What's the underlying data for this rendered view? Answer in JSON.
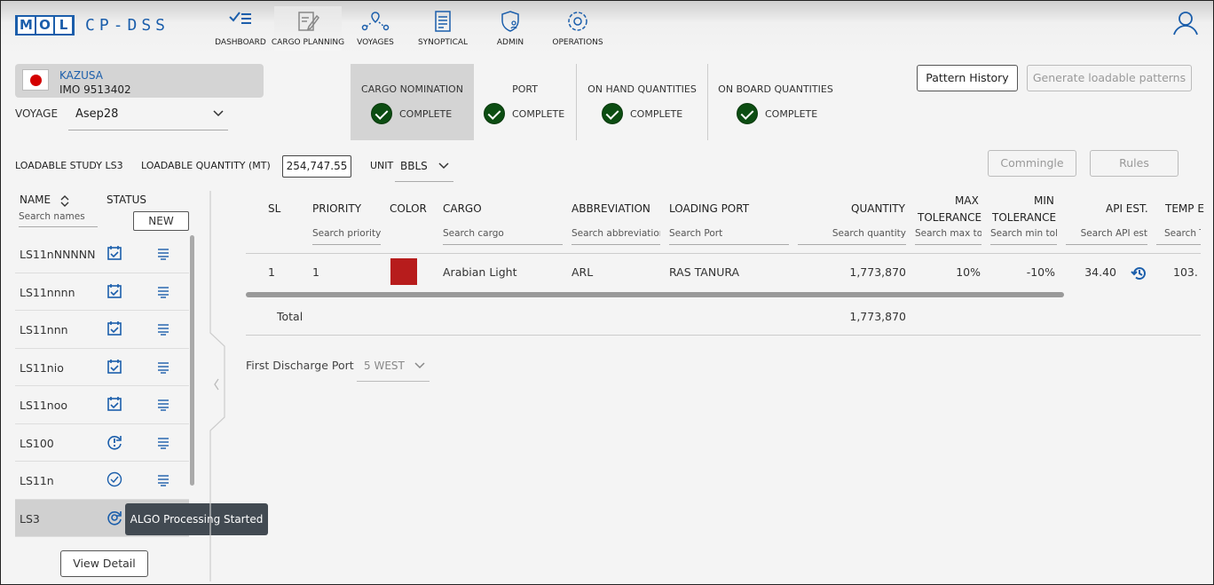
{
  "app": {
    "logo_letters": [
      "M",
      "O",
      "L"
    ],
    "logo_name": "CP-DSS"
  },
  "nav": [
    {
      "label": "DASHBOARD",
      "icon": "dashboard-icon"
    },
    {
      "label": "CARGO PLANNING",
      "icon": "cargo-planning-icon",
      "active": true
    },
    {
      "label": "VOYAGES",
      "icon": "voyages-icon"
    },
    {
      "label": "SYNOPTICAL",
      "icon": "synoptical-icon"
    },
    {
      "label": "ADMIN",
      "icon": "admin-icon"
    },
    {
      "label": "OPERATIONS",
      "icon": "operations-icon"
    }
  ],
  "vessel": {
    "name": "KAZUSA",
    "imo": "IMO 9513402",
    "flag": "japan-flag-icon"
  },
  "voyage": {
    "label": "VOYAGE",
    "value": "Asep28"
  },
  "steps": [
    {
      "title": "CARGO NOMINATION",
      "state": "COMPLETE"
    },
    {
      "title": "PORT",
      "state": "COMPLETE"
    },
    {
      "title": "ON HAND QUANTITIES",
      "state": "COMPLETE"
    },
    {
      "title": "ON BOARD QUANTITIES",
      "state": "COMPLETE"
    }
  ],
  "buttons": {
    "pattern_history": "Pattern History",
    "generate": "Generate loadable patterns",
    "commingle": "Commingle",
    "rules": "Rules",
    "new": "NEW",
    "view_detail": "View Detail"
  },
  "study": {
    "label": "LOADABLE STUDY LS3",
    "qty_label": "LOADABLE QUANTITY (MT)",
    "qty_value": "254,747.55",
    "unit_label": "UNIT",
    "unit_value": "BBLS"
  },
  "list": {
    "name_header": "NAME",
    "status_header": "STATUS",
    "search_placeholder": "Search names",
    "items": [
      {
        "name": "LS11nNNNNN",
        "status": "calendar-check-icon"
      },
      {
        "name": "LS11nnnn",
        "status": "calendar-check-icon"
      },
      {
        "name": "LS11nnn",
        "status": "calendar-check-icon"
      },
      {
        "name": "LS11nio",
        "status": "calendar-check-icon"
      },
      {
        "name": "LS11noo",
        "status": "calendar-check-icon"
      },
      {
        "name": "LS100",
        "status": "alert-sync-icon"
      },
      {
        "name": "LS11n",
        "status": "check-circle-icon"
      },
      {
        "name": "LS3",
        "status": "processing-icon",
        "selected": true
      }
    ],
    "tooltip": "ALGO Processing Started"
  },
  "table": {
    "headers": {
      "sl": "SL",
      "priority": "PRIORITY",
      "color": "COLOR",
      "cargo": "CARGO",
      "abbreviation": "ABBREVIATION",
      "loading_port": "LOADING PORT",
      "quantity": "QUANTITY",
      "max_tol_1": "MAX",
      "max_tol_2": "TOLERANCE",
      "min_tol_1": "MIN",
      "min_tol_2": "TOLERANCE",
      "api": "API EST.",
      "temp": "TEMP E"
    },
    "search": {
      "priority": "Search priority",
      "cargo": "Search cargo",
      "abbreviation": "Search abbreviation",
      "port": "Search Port",
      "quantity": "Search quantity",
      "max_tol": "Search max tol",
      "min_tol": "Search min tol",
      "api": "Search API est",
      "temp": "Search T"
    },
    "rows": [
      {
        "sl": "1",
        "priority": "1",
        "color": "#b71c1c",
        "cargo": "Arabian Light",
        "abbreviation": "ARL",
        "loading_port": "RAS TANURA",
        "quantity": "1,773,870",
        "max_tol": "10%",
        "min_tol": "-10%",
        "api": "34.40",
        "temp": "103."
      }
    ],
    "total_label": "Total",
    "total_quantity": "1,773,870"
  },
  "discharge": {
    "label": "First Discharge Port",
    "value": "5 WEST"
  }
}
